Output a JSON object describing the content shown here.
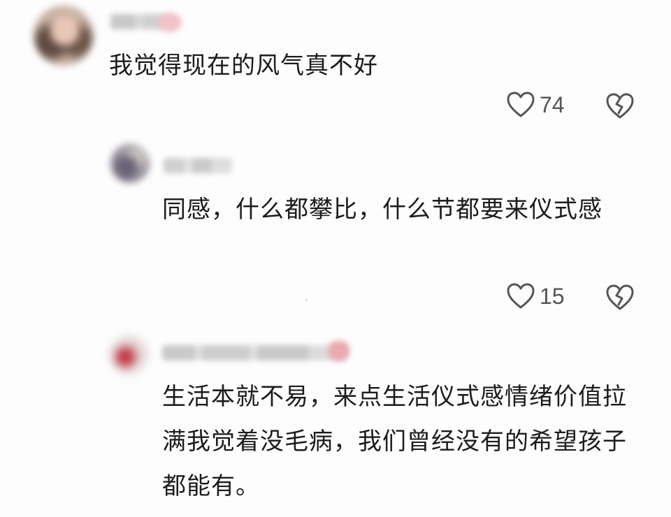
{
  "comments": [
    {
      "text": "我觉得现在的风气真不好",
      "likes": "74",
      "like_icon": "heart-outline-icon",
      "dislike_icon": "broken-heart-icon"
    },
    {
      "text": "同感，什么都攀比，什么节都要来仪式感",
      "likes": "15",
      "like_icon": "heart-outline-icon",
      "dislike_icon": "broken-heart-icon"
    },
    {
      "text": "生活本就不易，来点生活仪式感情绪价值拉满我觉着没毛病，我们曾经没有的希望孩子都能有。"
    }
  ],
  "colors": {
    "background": "#fdfdfd",
    "text": "#1c1c1c",
    "icon": "#555555"
  }
}
